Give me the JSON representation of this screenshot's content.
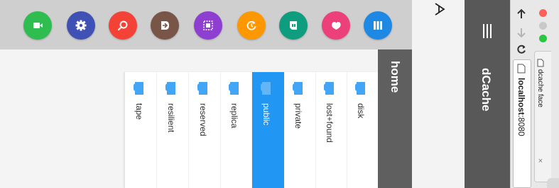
{
  "apps": [
    {
      "name": "camera-app",
      "color": "#2ebd4e"
    },
    {
      "name": "settings-app",
      "color": "#3f51b5"
    },
    {
      "name": "search-app",
      "color": "#f44336"
    },
    {
      "name": "share-app",
      "color": "#795548"
    },
    {
      "name": "select-app",
      "color": "#8e3ed1"
    },
    {
      "name": "refresh-app",
      "color": "#ff9800"
    },
    {
      "name": "storage-app",
      "color": "#0f9d7f"
    },
    {
      "name": "favorite-app",
      "color": "#ec407a"
    },
    {
      "name": "library-app",
      "color": "#1e88e5"
    }
  ],
  "folders": [
    {
      "label": "tape",
      "active": false
    },
    {
      "label": "resilient",
      "active": false
    },
    {
      "label": "reserved",
      "active": false
    },
    {
      "label": "replica",
      "active": false
    },
    {
      "label": "public",
      "active": true
    },
    {
      "label": "private",
      "active": false
    },
    {
      "label": "lost+found",
      "active": false
    },
    {
      "label": "disk",
      "active": false
    }
  ],
  "home_tab": {
    "label": "home"
  },
  "sidebar": {
    "title": "dCache"
  },
  "letter_icon": {
    "label": "A"
  },
  "browser": {
    "address_host": "localhost",
    "address_port": ":8080",
    "tab_title": "dcache face",
    "tab_close": "×"
  },
  "colors": {
    "accent": "#2196f3",
    "folder_icon": "#42a5f5",
    "sidebar": "#585858"
  }
}
